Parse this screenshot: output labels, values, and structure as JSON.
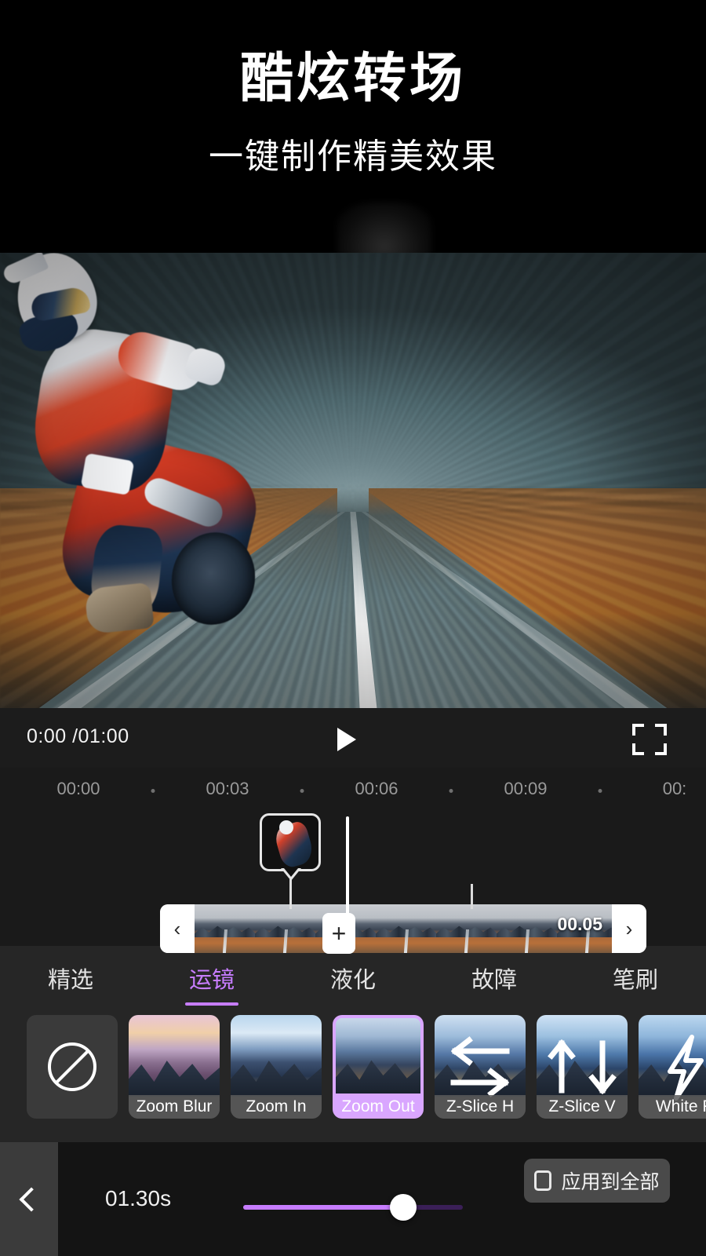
{
  "promo": {
    "title": "酷炫转场",
    "subtitle": "一键制作精美效果"
  },
  "player": {
    "time_display": "0:00 /01:00",
    "play_icon": "play-triangle-icon",
    "fullscreen_icon": "fullscreen-icon"
  },
  "timeline": {
    "ruler_labels": [
      "00:00",
      "00:03",
      "00:06",
      "00:09",
      "00:"
    ],
    "clip_duration_label": "00.05",
    "add_transition_label": "+",
    "prev_arrow": "‹",
    "next_arrow": "›",
    "frame_count": 7
  },
  "effects": {
    "tabs": [
      {
        "label": "精选",
        "active": false
      },
      {
        "label": "运镜",
        "active": true
      },
      {
        "label": "液化",
        "active": false
      },
      {
        "label": "故障",
        "active": false
      },
      {
        "label": "笔刷",
        "active": false
      }
    ],
    "cards": [
      {
        "label": "",
        "kind": "none",
        "selected": false
      },
      {
        "label": "Zoom Blur",
        "kind": "image",
        "selected": false
      },
      {
        "label": "Zoom In",
        "kind": "image",
        "selected": false
      },
      {
        "label": "Zoom Out",
        "kind": "image",
        "selected": true
      },
      {
        "label": "Z-Slice H",
        "kind": "arrows-h",
        "selected": false
      },
      {
        "label": "Z-Slice V",
        "kind": "arrows-v",
        "selected": false
      },
      {
        "label": "White F",
        "kind": "bolt",
        "selected": false
      }
    ]
  },
  "bottom": {
    "back_icon": "chevron-left-icon",
    "duration_value": "01.30s",
    "slider_percent": 73,
    "apply_label": "应用到全部",
    "apply_checkbox": "unchecked-checkbox-icon"
  },
  "colors": {
    "accent": "#c77dff",
    "accent_light": "#d9a6ff",
    "panel": "#262626",
    "bar": "#1c1c1c",
    "timeline_bg": "#1a1a1a",
    "bottom_bg": "#141414"
  }
}
